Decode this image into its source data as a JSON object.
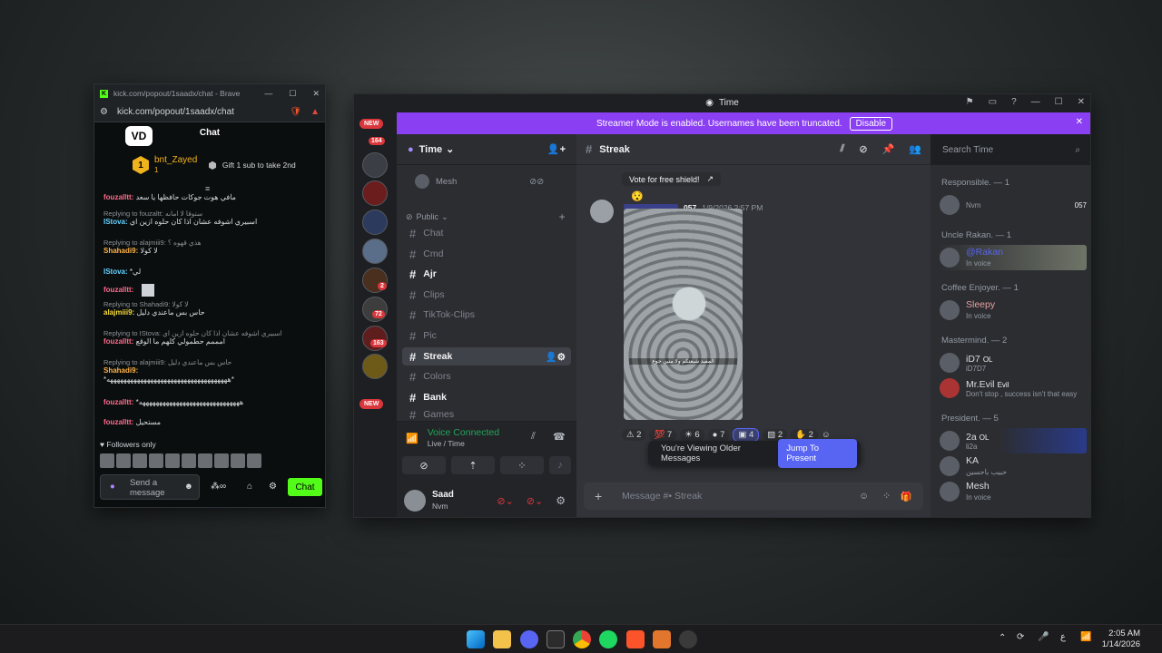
{
  "kick": {
    "window_title": "kick.com/popout/1saadx/chat - Brave",
    "url": "kick.com/popout/1saadx/chat",
    "chat_title": "Chat",
    "pinned": {
      "rank": "1",
      "user": "bnt_Zayed",
      "sub": "1",
      "gift_text": "Gift 1 sub to take 2nd"
    },
    "messages": [
      {
        "reply": "",
        "user": "fouzalltt:",
        "text": "مافي هوت جوكات حافظها يا سعد"
      },
      {
        "reply": "Replying to fouzaltt: ستوقا لا امانه",
        "user": "IStova:",
        "text": "اسبيري اشوفه عشان اذا كان حلوه ازين اي"
      },
      {
        "reply": "Replying to alajmiii9: هذي قهوه ؟",
        "user": "Shahadi9:",
        "text": "لا كولا"
      },
      {
        "reply": "",
        "user": "IStova:",
        "text": "*لي"
      },
      {
        "reply": "",
        "user": "fouzalltt:",
        "text": ""
      },
      {
        "reply": "Replying to Shahadi9: لا كولا",
        "user": "alajmiii9:",
        "text": "حاس بس ماعندي دليل"
      },
      {
        "reply": "Replying to IStova: اسبيري اشوفه عشان اذا كان حلوه ازين اي",
        "user": "fouzalltt:",
        "text": "امممم حطمولي كلهم ما الوقع"
      },
      {
        "reply": "Replying to alajmiii9: حاس بس ماعندي دليل",
        "user": "Shahadi9:",
        "text": "*ههههههههههههههههههههههههههههههههههههه*"
      },
      {
        "reply": "",
        "user": "fouzalltt:",
        "text": "*ههههههههههههههههههههههههههههههه"
      },
      {
        "reply": "",
        "user": "fouzalltt:",
        "text": "مستحيل"
      }
    ],
    "followers_only": "Followers only",
    "send_placeholder": "Send a message",
    "chat_button": "Chat"
  },
  "discord": {
    "window_title": "Time",
    "streamer_text": "Streamer Mode is enabled. Usernames have been truncated.",
    "disable_label": "Disable",
    "server_name": "Time",
    "server_badges": [
      "NEW",
      "164",
      "2",
      "72",
      "163",
      "NEW"
    ],
    "voice_user": "Mesh",
    "category": "Public",
    "channels": [
      {
        "name": "Chat",
        "state": "read"
      },
      {
        "name": "Cmd",
        "state": "read"
      },
      {
        "name": "Ajr",
        "state": "unread"
      },
      {
        "name": "Clips",
        "state": "read"
      },
      {
        "name": "TikTok-Clips",
        "state": "read"
      },
      {
        "name": "Pic",
        "state": "read"
      },
      {
        "name": "Streak",
        "state": "active"
      },
      {
        "name": "Colors",
        "state": "read"
      },
      {
        "name": "Bank",
        "state": "unread"
      },
      {
        "name": "Games",
        "state": "read"
      }
    ],
    "voice": {
      "status": "Voice Connected",
      "location": "Live / Time"
    },
    "me": {
      "name": "Saad",
      "status": "Nvm"
    },
    "channel_title": "Streak",
    "search_placeholder": "Search Time",
    "vote_text": "Vote for free shield!",
    "post_meta": {
      "badge": "057",
      "time": "1/9/2026 2:57 PM"
    },
    "image_caption": "المفيد شبعتكم ولا منين جوع",
    "reactions": [
      "2",
      "7",
      "6",
      "7",
      "4",
      "2",
      "2"
    ],
    "older_text": "You're Viewing Older Messages",
    "jump_label": "Jump To Present",
    "message_placeholder": "Message #• Streak",
    "member_groups": [
      {
        "title": "Responsible. — 1",
        "members": [
          {
            "name": "",
            "sub": "Nvm",
            "badge": "057"
          }
        ]
      },
      {
        "title": "Uncle Rakan. — 1",
        "members": [
          {
            "name": "@Rakan",
            "sub": "In voice",
            "badge": ""
          }
        ]
      },
      {
        "title": "Coffee Enjoyer. — 1",
        "members": [
          {
            "name": "Sleepy",
            "sub": "In voice",
            "badge": ""
          }
        ]
      },
      {
        "title": "Mastermind. — 2",
        "members": [
          {
            "name": "iD7",
            "sub": "iD7D7",
            "badge": "OL"
          },
          {
            "name": "Mr.Evil",
            "sub": "Don't stop , success isn't that easy",
            "badge": "Evil"
          }
        ]
      },
      {
        "title": "President. — 5",
        "members": [
          {
            "name": "2a",
            "sub": "li2a",
            "badge": "OL"
          },
          {
            "name": "KA",
            "sub": "حبيب باحسين",
            "badge": ""
          },
          {
            "name": "Mesh",
            "sub": "In voice",
            "badge": ""
          }
        ]
      }
    ]
  },
  "taskbar": {
    "time": "2:05 AM",
    "date": "1/14/2026",
    "lang": "ع"
  }
}
